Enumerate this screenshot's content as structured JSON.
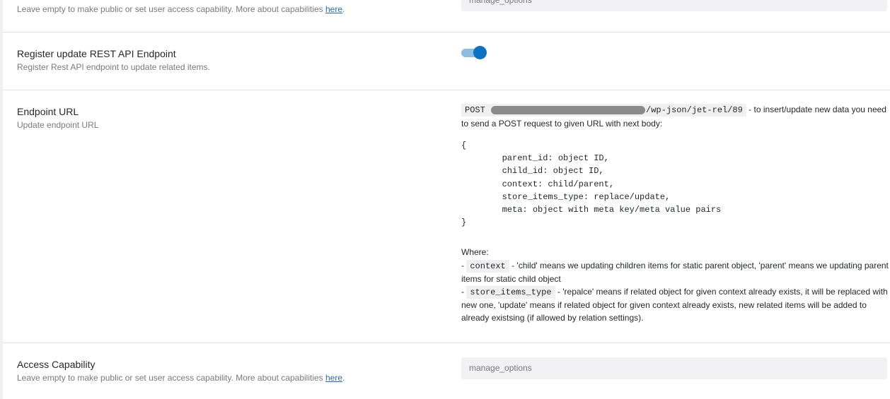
{
  "sections": {
    "top_partial": {
      "description": "Leave empty to make public or set user access capability. More about capabilities ",
      "description_link": "here",
      "description_end": ".",
      "input_placeholder": "manage_options"
    },
    "register_endpoint": {
      "label": "Register update REST API Endpoint",
      "description": "Register Rest API endpoint to update related items.",
      "toggle_on": true
    },
    "endpoint_url": {
      "label": "Endpoint URL",
      "description": "Update endpoint URL",
      "method": "POST",
      "path": "/wp-json/jet-rel/89",
      "intro_text": " - to insert/update new data you need to send a POST request to given URL with next body:",
      "body_open": "{",
      "body_lines": [
        "parent_id: object ID,",
        "child_id: object ID,",
        "context: child/parent,",
        "store_items_type: replace/update,",
        "meta: object with meta key/meta value pairs"
      ],
      "body_close": "}",
      "where_label": "Where:",
      "context_key": "context",
      "context_text": " - 'child' means we updating children items for static parent object, 'parent' means we updating parent items for static child object",
      "store_key": "store_items_type",
      "store_text": " - 'repalce' means if related object for given context already exists, it will be replaced with new one, 'update' means if related object for given context already exists, new related items will be added to already existsing (if allowed by relation settings)."
    },
    "access_capability": {
      "label": "Access Capability",
      "description": "Leave empty to make public or set user access capability. More about capabilities ",
      "description_link": "here",
      "description_end": ".",
      "input_placeholder": "manage_options"
    }
  }
}
